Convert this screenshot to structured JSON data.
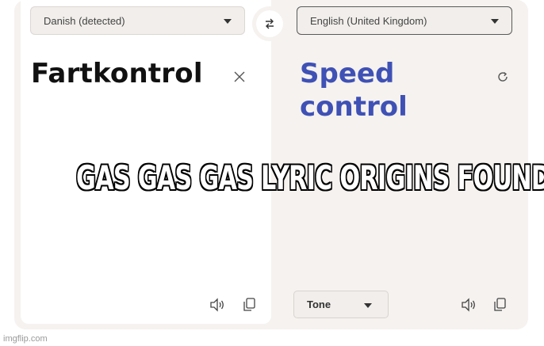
{
  "source": {
    "language": "Danish (detected)",
    "text": "Fartkontrol"
  },
  "target": {
    "language": "English (United Kingdom)",
    "line1": "Speed",
    "line2": "control",
    "tone_label": "Tone"
  },
  "icons": {
    "swap": "swap-arrows-icon",
    "clear": "close-icon",
    "refresh": "refresh-icon",
    "speaker": "speaker-icon",
    "copy": "copy-icon",
    "dropdown": "chevron-down-icon"
  },
  "colors": {
    "translation_text": "#3f51b5",
    "panel_background": "#f5f2ef"
  },
  "overlay": {
    "caption": "GAS GAS GAS LYRIC ORIGINS FOUND",
    "watermark": "imgflip.com"
  }
}
